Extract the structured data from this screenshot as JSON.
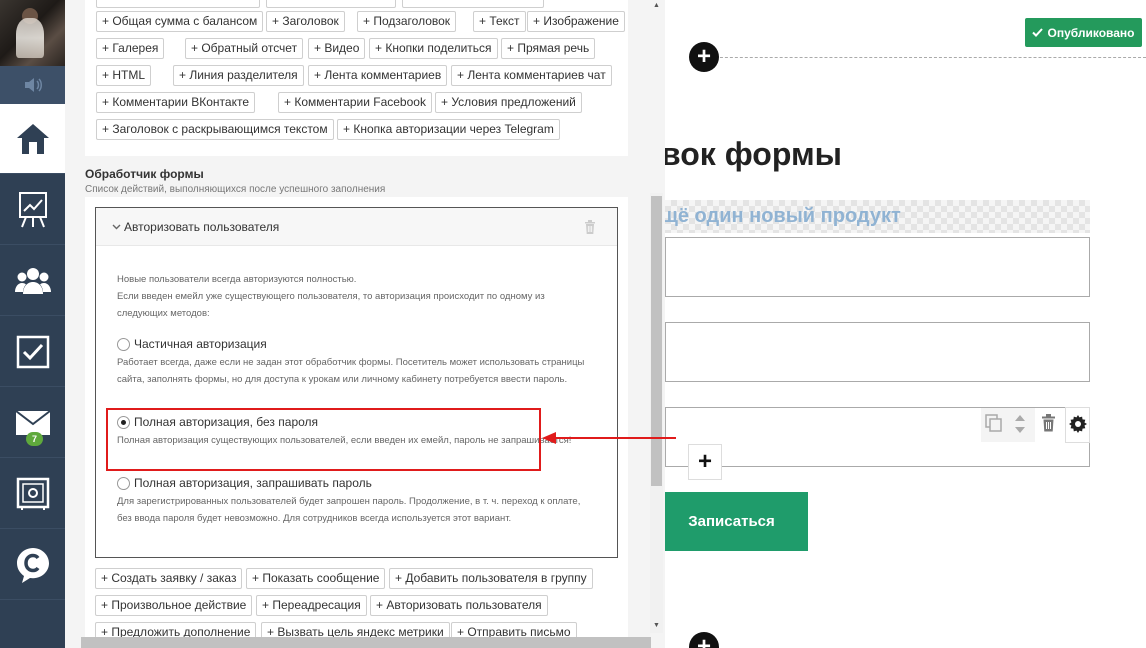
{
  "sidebar": {
    "avatar_icon": "avatar-photo",
    "sound_icon": "speaker-icon",
    "items": [
      {
        "name": "home",
        "icon": "home-icon"
      },
      {
        "name": "stats",
        "icon": "chart-board-icon"
      },
      {
        "name": "users",
        "icon": "users-icon"
      },
      {
        "name": "tasks",
        "icon": "checkbox-icon"
      },
      {
        "name": "messages",
        "icon": "envelope-icon",
        "badge": "7"
      },
      {
        "name": "settings",
        "icon": "safe-icon"
      },
      {
        "name": "chat",
        "icon": "chat-c-icon"
      }
    ]
  },
  "blocks": {
    "rows": [
      [
        "+ Общая сумма с балансом",
        "+ Заголовок",
        "+ Подзаголовок",
        "+ Текст",
        "+ Изображение"
      ],
      [
        "+ Галерея",
        "+ Обратный отсчет",
        "+ Видео",
        "+ Кнопки поделиться",
        "+ Прямая речь"
      ],
      [
        "+ HTML",
        "+ Линия разделителя",
        "+ Лента комментариев",
        "+ Лента комментариев чат"
      ],
      [
        "+ Комментарии ВКонтакте",
        "+ Комментарии Facebook",
        "+ Условия предложений"
      ],
      [
        "+ Заголовок с раскрывающимся текстом",
        "+ Кнопка авторизации через Telegram"
      ]
    ]
  },
  "handler_section": {
    "title": "Обработчик формы",
    "subtitle": "Список действий, выполняющихся после успешного заполнения"
  },
  "handler": {
    "title": "Авторизовать пользователя",
    "info_1": "Новые пользователи всегда авторизуются полностью.",
    "info_2": "Если введен емейл уже существующего пользователя, то авторизация происходит по одному из следующих методов:",
    "options": [
      {
        "label": "Частичная авторизация",
        "desc": "Работает всегда, даже если не задан этот обработчик формы. Посетитель может использовать страницы сайта, заполнять формы, но для доступа к урокам или личному кабинету потребуется ввести пароль.",
        "selected": false
      },
      {
        "label": "Полная авторизация, без пароля",
        "desc": "Полная авторизация существующих пользователей, если введен их емейл, пароль не запрашивается!",
        "selected": true
      },
      {
        "label": "Полная авторизация, запрашивать пароль",
        "desc": "Для зарегистрированных пользователей будет запрошен пароль. Продолжение, в т. ч. переход к оплате, без ввода пароля будет невозможно. Для сотрудников всегда используется этот вариант.",
        "selected": false
      }
    ]
  },
  "actions": {
    "rows": [
      [
        "+ Создать заявку / заказ",
        "+ Показать сообщение",
        "+ Добавить пользователя в группу"
      ],
      [
        "+ Произвольное действие",
        "+ Переадресация",
        "+ Авторизовать пользователя"
      ],
      [
        "+ Предложить дополнение",
        "+ Вызвать цель яндекс метрики",
        "+ Отправить письмо"
      ]
    ]
  },
  "editor": {
    "publish_label": "Опубликовано",
    "heading_fragment": "вок формы",
    "subheading_fragment": "щё один новый продукт",
    "button_label": "Записаться",
    "plus": "+"
  },
  "colors": {
    "sidebar": "#2f4054",
    "publish": "#249a5c",
    "signup": "#1f9c6b",
    "highlight": "#e01b1b",
    "subheading": "#90b3d3"
  }
}
